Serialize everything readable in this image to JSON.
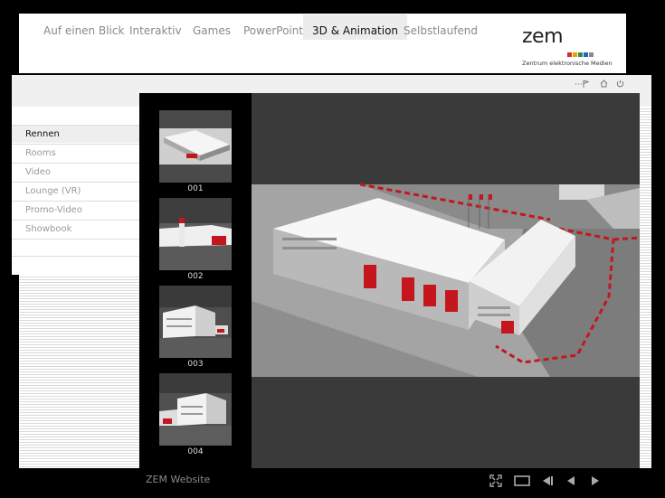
{
  "nav": {
    "tabs": [
      {
        "label": "Auf einen Blick"
      },
      {
        "label": "Interaktiv"
      },
      {
        "label": "Games"
      },
      {
        "label": "PowerPoint"
      },
      {
        "label": "3D & Animation",
        "active": true
      },
      {
        "label": "Selbstlaufend"
      }
    ]
  },
  "logo": {
    "text": "zem",
    "subtitle": "Zentrum elektronische Medien",
    "colors": [
      "#d32f2f",
      "#e6a000",
      "#2e8b57",
      "#1f66c1",
      "#888888"
    ]
  },
  "toolbar": {
    "icons": [
      "more-icon",
      "flag-icon",
      "home-icon",
      "power-icon"
    ],
    "more_text": "····"
  },
  "sidebar": {
    "items": [
      {
        "label": "Rennen",
        "active": true
      },
      {
        "label": "Rooms"
      },
      {
        "label": "Video"
      },
      {
        "label": "Lounge (VR)"
      },
      {
        "label": "Promo-Video"
      },
      {
        "label": "Showbook"
      }
    ]
  },
  "gallery": {
    "thumbnails": [
      {
        "label": "001"
      },
      {
        "label": "002"
      },
      {
        "label": "003"
      },
      {
        "label": "004"
      }
    ]
  },
  "footer": {
    "label": "ZEM Website",
    "controls": [
      "fullscreen-icon",
      "window-icon",
      "skip-back-icon",
      "prev-icon",
      "next-icon"
    ]
  },
  "colors": {
    "accent_red": "#c4161c",
    "stage_bg": "#3c3c3c"
  }
}
